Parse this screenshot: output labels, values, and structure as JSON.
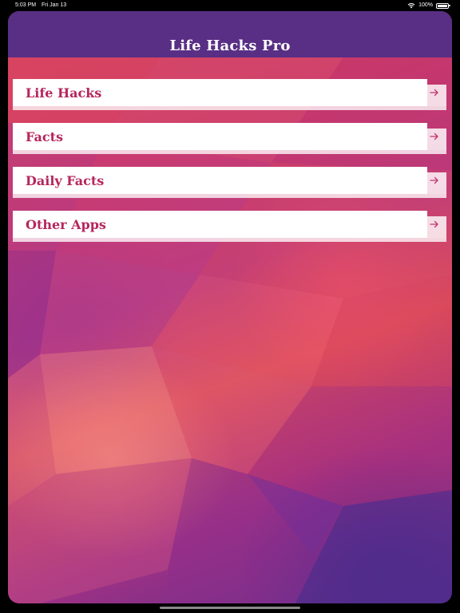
{
  "status_bar": {
    "time": "5:03 PM",
    "date": "Fri Jan 13",
    "battery": "100%"
  },
  "app": {
    "title": "Life Hacks Pro"
  },
  "menu": {
    "items": [
      {
        "label": "Life Hacks",
        "icon": "arrow-right-icon"
      },
      {
        "label": "Facts",
        "icon": "arrow-right-icon"
      },
      {
        "label": "Daily Facts",
        "icon": "arrow-right-icon"
      },
      {
        "label": "Other Apps",
        "icon": "arrow-right-icon"
      }
    ]
  },
  "colors": {
    "nav_bar": "#592f85",
    "menu_text": "#b5265c",
    "arrow": "#c2356d"
  }
}
